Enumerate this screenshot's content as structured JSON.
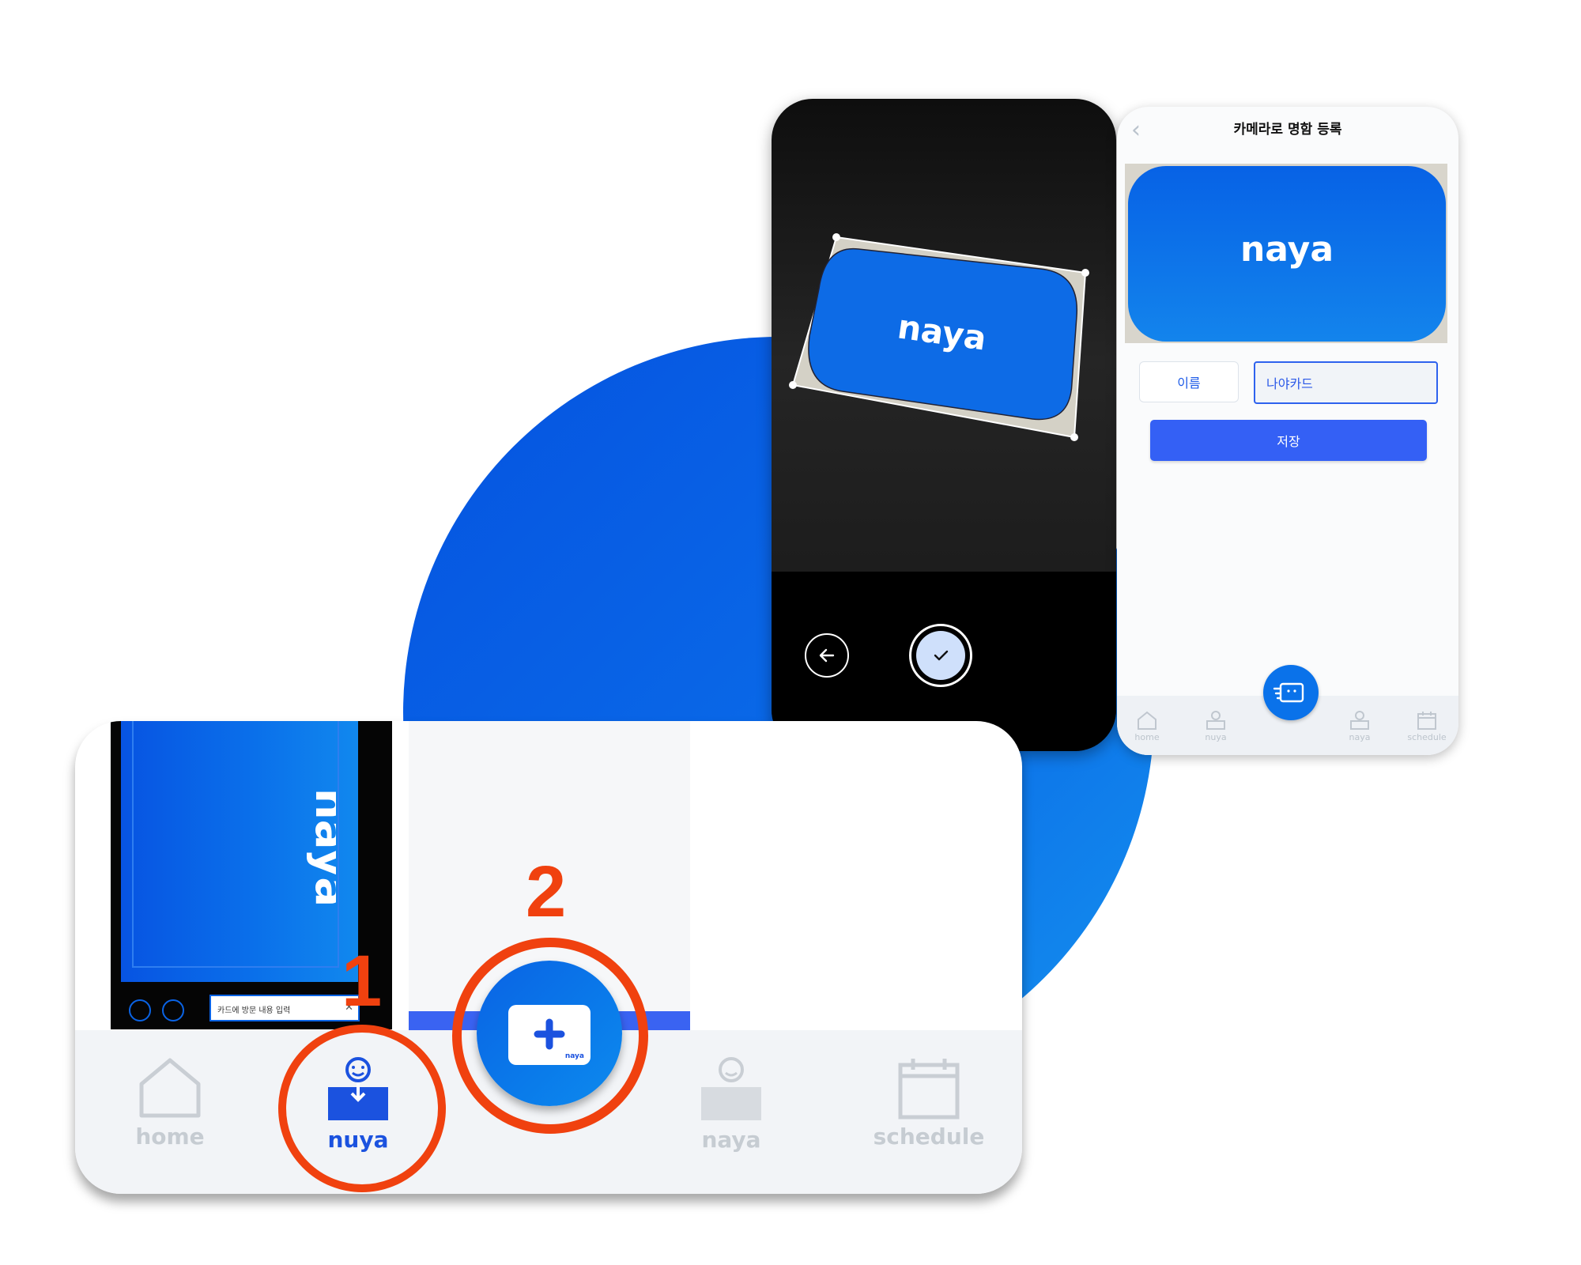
{
  "brand": {
    "logo": "naya",
    "accent": "#0A6AE8",
    "annotation_color": "#F0410F"
  },
  "steps": {
    "one": "1",
    "two": "2"
  },
  "camera": {
    "logo": "naya",
    "back_icon": "arrow-left-icon",
    "confirm_icon": "check-icon"
  },
  "register": {
    "title": "카메라로 명함 등록",
    "card_logo": "naya",
    "field_label": "이름",
    "field_value": "나야카드",
    "save_label": "저장",
    "tabs": [
      {
        "label": "home",
        "icon": "home-icon"
      },
      {
        "label": "nuya",
        "icon": "inbox-smile-icon"
      },
      {
        "label": "naya",
        "icon": "inbox-smile-icon"
      },
      {
        "label": "schedule",
        "icon": "calendar-icon"
      }
    ]
  },
  "card_preview": {
    "logo": "naya",
    "input_text": "카드에 방문 내용 입력"
  },
  "add_button": {
    "sub_label": "naya"
  },
  "tabbar": {
    "tabs": [
      {
        "label": "home",
        "icon": "home-icon",
        "active": false
      },
      {
        "label": "nuya",
        "icon": "inbox-smile-icon",
        "active": true
      },
      {
        "label": "naya",
        "icon": "inbox-smile-icon",
        "active": false
      },
      {
        "label": "schedule",
        "icon": "calendar-icon",
        "active": false
      }
    ]
  }
}
